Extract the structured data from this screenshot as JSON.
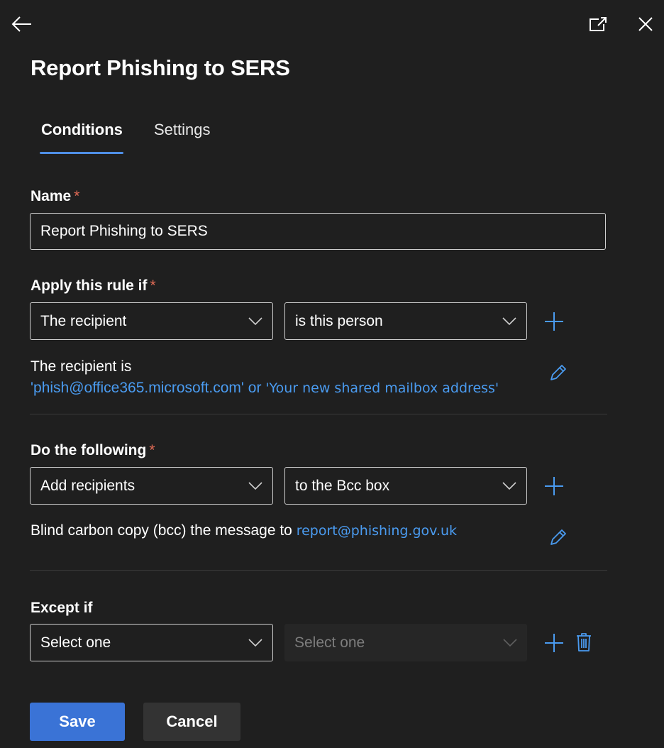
{
  "header": {
    "back_icon": "arrow-left-icon",
    "popout_icon": "open-in-new-window-icon",
    "close_icon": "close-icon",
    "title": "Report Phishing to SERS"
  },
  "tabs": [
    {
      "label": "Conditions",
      "active": true
    },
    {
      "label": "Settings",
      "active": false
    }
  ],
  "name_field": {
    "label": "Name",
    "required_mark": "*",
    "value": "Report Phishing to SERS"
  },
  "apply_rule": {
    "label": "Apply this rule if",
    "required_mark": "*",
    "condition": "The recipient",
    "operator": "is this person",
    "summary_prefix": "The recipient is",
    "value_1": "'phish@office365.microsoft.com'",
    "connector": "or",
    "value_2": "'Your new shared mailbox address'"
  },
  "do_following": {
    "label": "Do the following",
    "required_mark": "*",
    "action": "Add recipients",
    "target": "to the Bcc box",
    "summary_prefix": "Blind carbon copy (bcc) the message to",
    "value": "report@phishing.gov.uk"
  },
  "except_if": {
    "label": "Except if",
    "condition": "Select one",
    "operator": "Select one"
  },
  "footer": {
    "save_label": "Save",
    "cancel_label": "Cancel"
  },
  "colors": {
    "background": "#1f1f1f",
    "accent": "#4f8fe6",
    "link": "#4a9bf0",
    "primary_button": "#3a73d6",
    "secondary_button": "#333333",
    "required": "#e06a55"
  }
}
